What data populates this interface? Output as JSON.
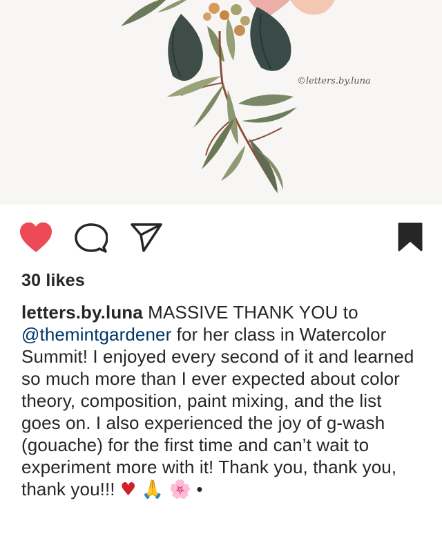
{
  "post": {
    "watermark": "©letters.by.luna",
    "likes_text": "30 likes",
    "caption": {
      "username": "letters.by.luna",
      "text_before_mention": " MASSIVE THANK YOU to ",
      "mention": "@themintgardener",
      "text_after_mention": " for her class in Watercolor Summit!  I enjoyed every second of it and learned so much more than I ever expected about color theory, composition, paint mixing, and the list goes on. I also experienced the joy of g-wash (gouache) for the first time and can’t wait to experiment more with it!  Thank you, thank you, thank you!!! ",
      "emoji_heart": "♥",
      "emoji_pray": "🙏",
      "emoji_blossom": "🌸",
      "trailing": " •"
    }
  },
  "actions": {
    "like_icon": "heart-filled-icon",
    "comment_icon": "comment-bubble-icon",
    "share_icon": "paper-plane-icon",
    "save_icon": "bookmark-filled-icon"
  },
  "colors": {
    "like_red": "#ed4956",
    "text": "#262626",
    "mention_blue": "#003569",
    "image_bg": "#f7f6f4"
  }
}
